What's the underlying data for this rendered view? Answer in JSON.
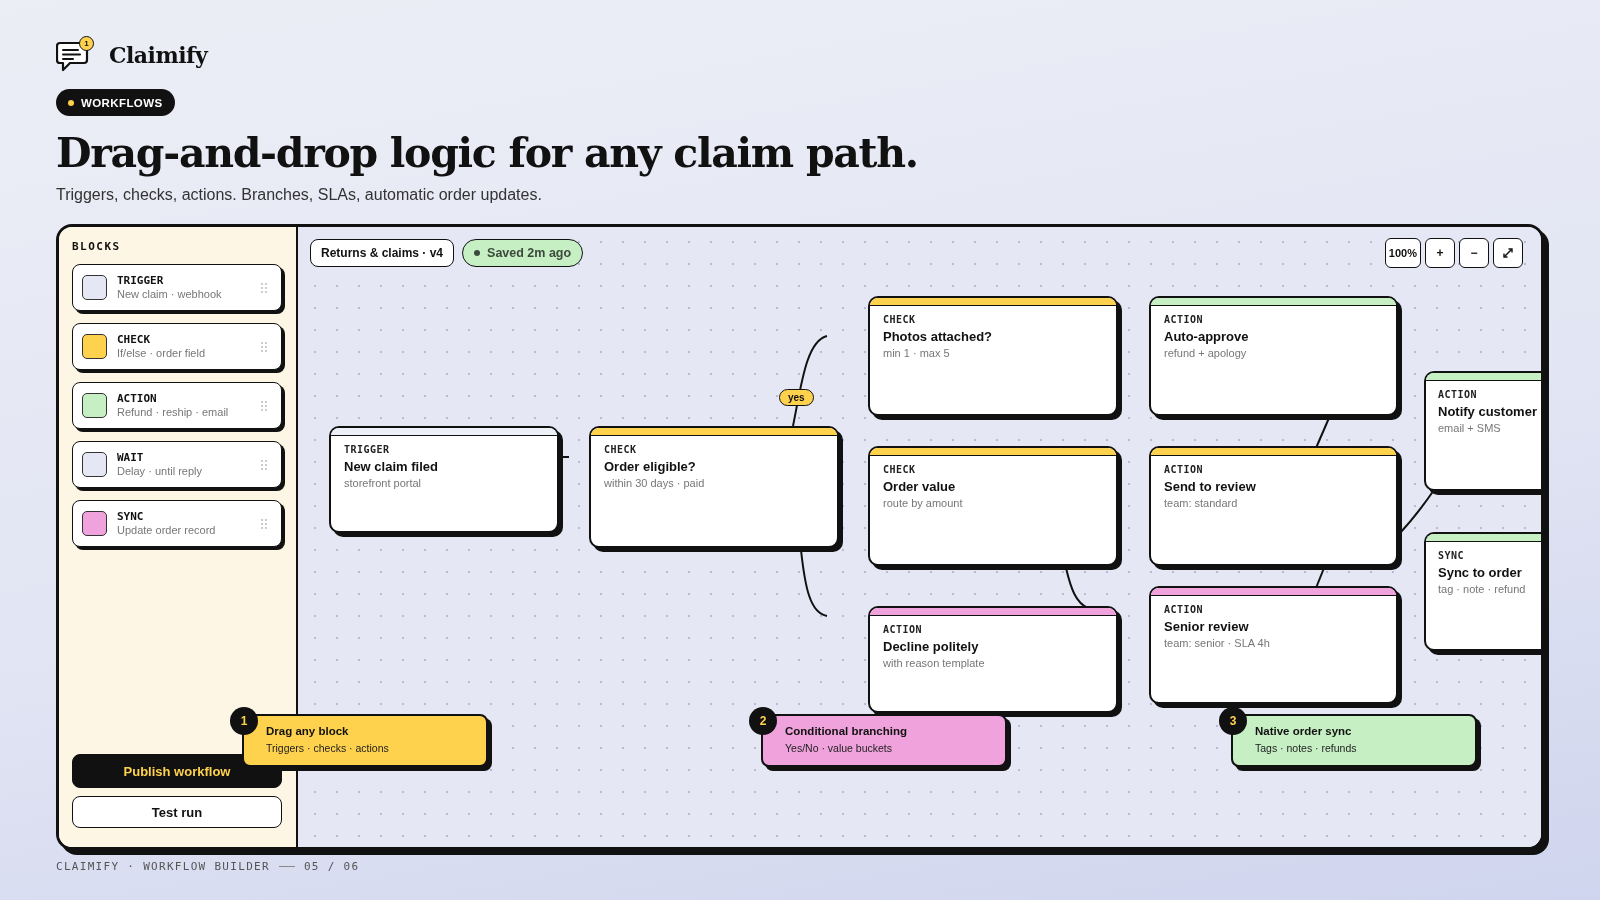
{
  "brand": {
    "name": "Claimify",
    "badge": "1"
  },
  "eyebrow": "WORKFLOWS",
  "headline": "Drag-and-drop logic for any claim path.",
  "subhead": "Triggers, checks, actions. Branches, SLAs, automatic order updates.",
  "sidebar": {
    "title": "BLOCKS",
    "blocks": [
      {
        "name": "TRIGGER",
        "detail": "New claim · webhook",
        "color": "#e6e7f4"
      },
      {
        "name": "CHECK",
        "detail": "If/else · order field",
        "color": "#ffd24d"
      },
      {
        "name": "ACTION",
        "detail": "Refund · reship · email",
        "color": "#c6efc4"
      },
      {
        "name": "WAIT",
        "detail": "Delay · until reply",
        "color": "#e6e7f4"
      },
      {
        "name": "SYNC",
        "detail": "Update order record",
        "color": "#f0a2dc"
      }
    ],
    "buttons": [
      {
        "kind": "primary",
        "label": "Publish workflow"
      },
      {
        "kind": "secondary",
        "label": "Test run"
      }
    ]
  },
  "toolbar": {
    "workflow": "Returns & claims · v4",
    "status": "Saved 2m ago",
    "zoom_controls": [
      {
        "kind": "level",
        "label": "100%"
      },
      {
        "kind": "in",
        "label": "+"
      },
      {
        "kind": "out",
        "label": "−"
      },
      {
        "kind": "fit"
      }
    ]
  },
  "canvas": {
    "branch_label": "yes",
    "nodes": [
      {
        "type": "TRIGGER",
        "title": "New claim filed",
        "detail": "storefront portal",
        "color": "#eef0f8"
      },
      {
        "type": "CHECK",
        "title": "Order eligible?",
        "detail": "within 30 days · paid",
        "color": "#ffd24d"
      },
      {
        "type": "CHECK",
        "title": "Photos attached?",
        "detail": "min 1 · max 5",
        "color": "#ffd24d"
      },
      {
        "type": "CHECK",
        "title": "Order value",
        "detail": "route by amount",
        "color": "#ffd24d"
      },
      {
        "type": "ACTION",
        "title": "Decline politely",
        "detail": "with reason template",
        "color": "#f0a2dc"
      },
      {
        "type": "ACTION",
        "title": "Auto-approve",
        "detail": "refund + apology",
        "color": "#c6efc4"
      },
      {
        "type": "ACTION",
        "title": "Send to review",
        "detail": "team: standard",
        "color": "#ffd24d"
      },
      {
        "type": "ACTION",
        "title": "Senior review",
        "detail": "team: senior · SLA 4h",
        "color": "#f0a2dc"
      },
      {
        "type": "ACTION",
        "title": "Notify customer",
        "detail": "email + SMS",
        "color": "#c6efc4"
      },
      {
        "type": "SYNC",
        "title": "Sync to order",
        "detail": "tag · note · refund",
        "color": "#c6efc4"
      }
    ]
  },
  "callouts": [
    {
      "number": "1",
      "title": "Drag any block",
      "detail": "Triggers · checks · actions",
      "color": "#ffd24d"
    },
    {
      "number": "2",
      "title": "Conditional branching",
      "detail": "Yes/No · value buckets",
      "color": "#f0a2dc"
    },
    {
      "number": "3",
      "title": "Native order sync",
      "detail": "Tags · notes · refunds",
      "color": "#c6efc4"
    }
  ],
  "footer": {
    "title": "CLAIMIFY · WORKFLOW BUILDER",
    "page": "05 / 06"
  }
}
